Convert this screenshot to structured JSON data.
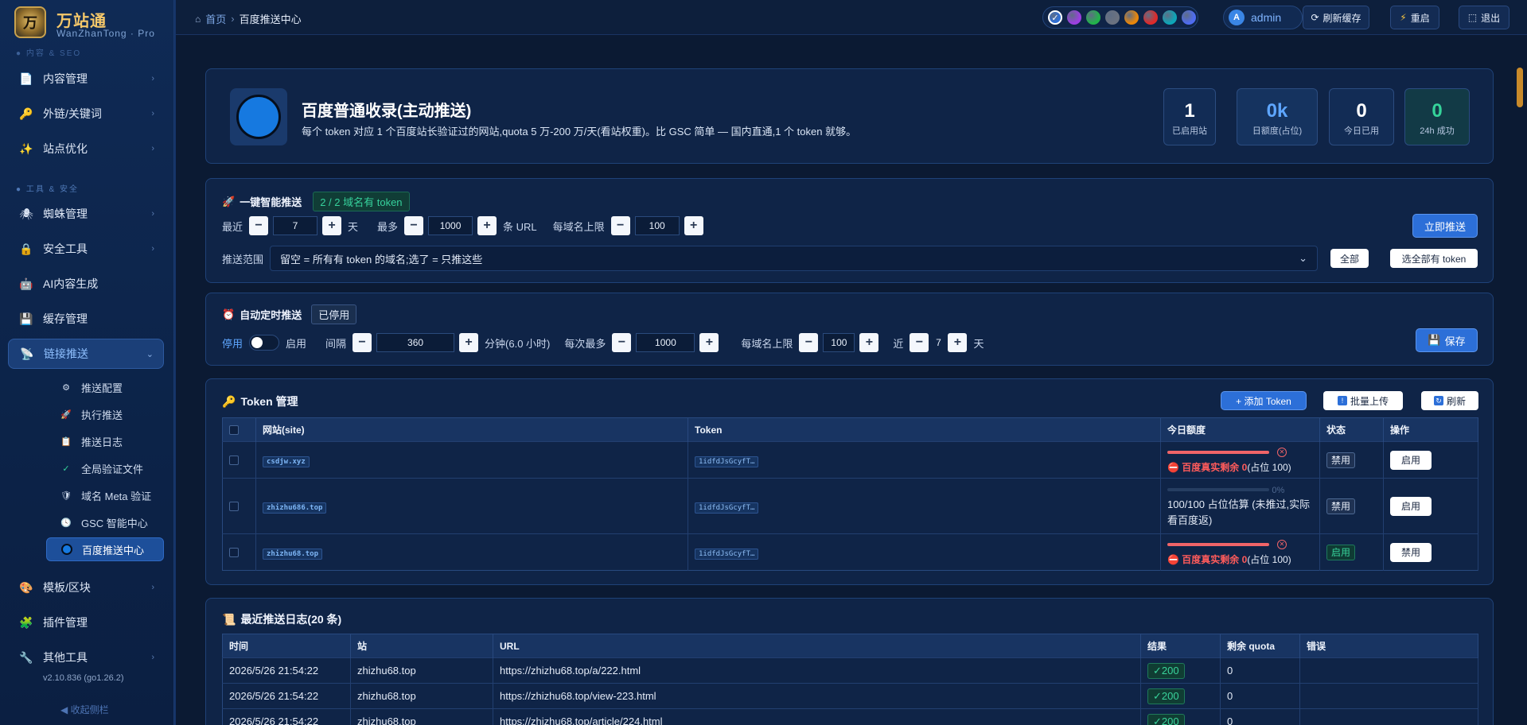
{
  "app": {
    "name": "万站通",
    "sub": "WanZhanTong · Pro",
    "logo_char": "万",
    "version": "v2.10.836 (go1.26.2)",
    "collapse": "◀ 收起侧栏"
  },
  "sidebar": {
    "section1": "● 内容 & SEO",
    "section2": "● 工具 & 安全",
    "items": [
      {
        "label": "内容管理",
        "icon": "document-icon",
        "glyph": "📄"
      },
      {
        "label": "外链/关键词",
        "icon": "key-icon",
        "glyph": "🔑"
      },
      {
        "label": "站点优化",
        "icon": "sparkle-icon",
        "glyph": "✨"
      },
      {
        "label": "蜘蛛管理",
        "icon": "spider-icon",
        "glyph": "🕷"
      },
      {
        "label": "安全工具",
        "icon": "lock-icon",
        "glyph": "🔒"
      },
      {
        "label": "AI内容生成",
        "icon": "robot-icon",
        "glyph": "🤖"
      },
      {
        "label": "缓存管理",
        "icon": "disk-icon",
        "glyph": "💾"
      },
      {
        "label": "链接推送",
        "icon": "satellite-icon",
        "glyph": "📡"
      },
      {
        "label": "模板/区块",
        "icon": "palette-icon",
        "glyph": "🎨"
      },
      {
        "label": "插件管理",
        "icon": "puzzle-icon",
        "glyph": "🧩"
      },
      {
        "label": "其他工具",
        "icon": "wrench-icon",
        "glyph": "🔧"
      }
    ],
    "subitems": [
      {
        "label": "推送配置",
        "icon": "gear-icon",
        "glyph": "⚙"
      },
      {
        "label": "执行推送",
        "icon": "rocket-icon",
        "glyph": "🚀"
      },
      {
        "label": "推送日志",
        "icon": "clipboard-icon",
        "glyph": "📋"
      },
      {
        "label": "全局验证文件",
        "icon": "check-icon",
        "glyph": "✓"
      },
      {
        "label": "域名 Meta 验证",
        "icon": "shield-icon",
        "glyph": "🛡"
      },
      {
        "label": "GSC 智能中心",
        "icon": "clock-icon",
        "glyph": "🕓"
      },
      {
        "label": "百度推送中心",
        "icon": "blue-circle-icon",
        "glyph": ""
      }
    ]
  },
  "topbar": {
    "home": "首页",
    "sep": "›",
    "current": "百度推送中心",
    "theme_colors": [
      "#2f6fd6",
      "#9b3fe0",
      "#23b24b",
      "#6b7280",
      "#e8860b",
      "#dd2b2b",
      "#0ea5b7",
      "#4f6cf0"
    ],
    "user_initial": "A",
    "user": "admin",
    "refresh_cache": "刷新缓存",
    "restart": "重启",
    "logout": "退出"
  },
  "hero": {
    "title": "百度普通收录(主动推送)",
    "desc": "每个 token 对应 1 个百度站长验证过的网站,quota 5 万-200 万/天(看站权重)。比 GSC 简单 — 国内直通,1 个 token 就够。",
    "stats": [
      {
        "value": "1",
        "label": "已启用站"
      },
      {
        "value": "0k",
        "label": "日额度(占位)"
      },
      {
        "value": "0",
        "label": "今日已用"
      },
      {
        "value": "0",
        "label": "24h 成功"
      }
    ]
  },
  "smart_push": {
    "title": "一键智能推送",
    "badge": "2 / 2 域名有 token",
    "recent_label": "最近",
    "recent_val": "7",
    "recent_unit": "天",
    "max_label": "最多",
    "max_val": "1000",
    "max_unit": "条 URL",
    "per_domain_label": "每域名上限",
    "per_domain_val": "100",
    "push_now": "立即推送",
    "scope_label": "推送范围",
    "scope_placeholder": "留空 = 所有有 token 的域名;选了 = 只推这些",
    "all_btn": "全部",
    "select_all_btn": "选全部有 token"
  },
  "auto_push": {
    "title": "自动定时推送",
    "badge": "已停用",
    "off_label": "停用",
    "on_label": "启用",
    "interval_label": "间隔",
    "interval_val": "360",
    "interval_unit": "分钟(6.0 小时)",
    "each_max_label": "每次最多",
    "each_max_val": "1000",
    "per_domain_label": "每域名上限",
    "per_domain_val": "100",
    "recent_label": "近",
    "recent_val": "7",
    "recent_unit": "天",
    "save": "保存"
  },
  "tokens": {
    "title": "Token 管理",
    "add": "+ 添加 Token",
    "bulk": "批量上传",
    "refresh": "刷新",
    "headers": [
      "网站(site)",
      "Token",
      "今日额度",
      "状态",
      "操作"
    ],
    "rows": [
      {
        "site": "csdjw.xyz",
        "token": "1idfdJsGcyfT…",
        "quota_type": "exhausted",
        "quota_text_red": "百度真实剩余 0",
        "quota_text": "(占位 100)",
        "status": "禁用",
        "status_on": false,
        "action": "启用"
      },
      {
        "site": "zhizhu686.top",
        "token": "1idfdJsGcyfT…",
        "quota_type": "estimate",
        "quota_pct": "0%",
        "quota_text": "100/100 占位估算 (未推过,实际看百度返)",
        "status": "禁用",
        "status_on": false,
        "action": "启用"
      },
      {
        "site": "zhizhu68.top",
        "token": "1idfdJsGcyfT…",
        "quota_type": "exhausted",
        "quota_text_red": "百度真实剩余 0",
        "quota_text": "(占位 100)",
        "status": "启用",
        "status_on": true,
        "action": "禁用"
      }
    ]
  },
  "logs": {
    "title": "最近推送日志(20 条)",
    "headers": [
      "时间",
      "站",
      "URL",
      "结果",
      "剩余 quota",
      "错误"
    ],
    "rows": [
      {
        "time": "2026/5/26 21:54:22",
        "site": "zhizhu68.top",
        "url": "https://zhizhu68.top/a/222.html",
        "result": "✓200",
        "quota": "0",
        "error": ""
      },
      {
        "time": "2026/5/26 21:54:22",
        "site": "zhizhu68.top",
        "url": "https://zhizhu68.top/view-223.html",
        "result": "✓200",
        "quota": "0",
        "error": ""
      },
      {
        "time": "2026/5/26 21:54:22",
        "site": "zhizhu68.top",
        "url": "https://zhizhu68.top/article/224.html",
        "result": "✓200",
        "quota": "0",
        "error": ""
      }
    ]
  }
}
